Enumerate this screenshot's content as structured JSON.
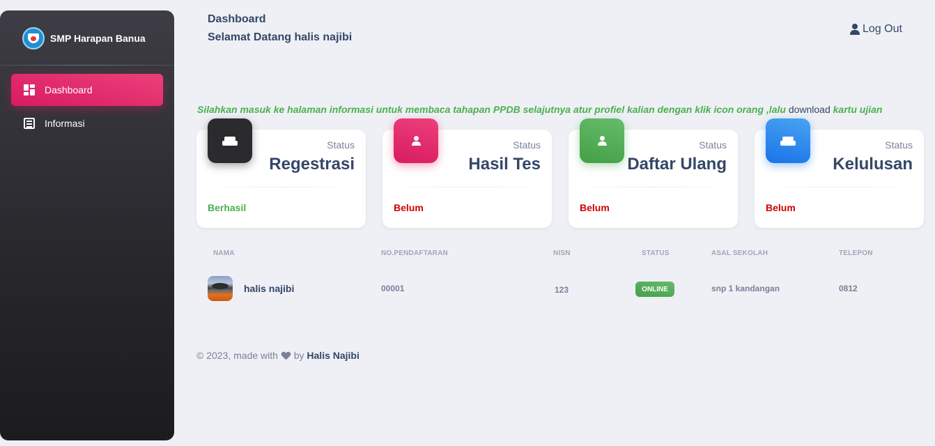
{
  "sidebar": {
    "brand": "SMP Harapan Banua",
    "items": [
      {
        "label": "Dashboard"
      },
      {
        "label": "Informasi"
      }
    ]
  },
  "header": {
    "breadcrumb": "Dashboard",
    "welcome": "Selamat Datang halis najibi",
    "logout": "Log Out"
  },
  "notice": {
    "text_before": "Silahkan masuk ke halaman informasi untuk membaca tahapan PPDB selajutnya atur profiel kalian dengan klik icon orang ,lalu ",
    "link": "download",
    "text_after": " kartu ujian"
  },
  "cards": [
    {
      "label": "Status",
      "value": "Regestrasi",
      "status": "Berhasil",
      "status_color": "#4caf50",
      "icon": "sofa-icon",
      "icon_bg": "#2b2b2e"
    },
    {
      "label": "Status",
      "value": "Hasil Tes",
      "status": "Belum",
      "status_color": "#d00000",
      "icon": "person-icon",
      "icon_bg": "#e91e63"
    },
    {
      "label": "Status",
      "value": "Daftar Ulang",
      "status": "Belum",
      "status_color": "#d00000",
      "icon": "person-icon",
      "icon_bg": "#4caf50"
    },
    {
      "label": "Status",
      "value": "Kelulusan",
      "status": "Belum",
      "status_color": "#d00000",
      "icon": "sofa-icon",
      "icon_bg": "#1a73e8"
    }
  ],
  "table": {
    "headers": [
      "NAMA",
      "NO.PENDAFTARAN",
      "NISN",
      "STATUS",
      "ASAL SEKOLAH",
      "TELEPON"
    ],
    "row": {
      "name": "halis najibi",
      "no_pendaftaran": "00001",
      "nisn": "123",
      "status": "ONLINE",
      "asal_sekolah": "snp 1 kandangan",
      "telepon": "0812"
    }
  },
  "footer": {
    "prefix": "© 2023, made with",
    "by": "by",
    "author": "Halis Najibi"
  }
}
